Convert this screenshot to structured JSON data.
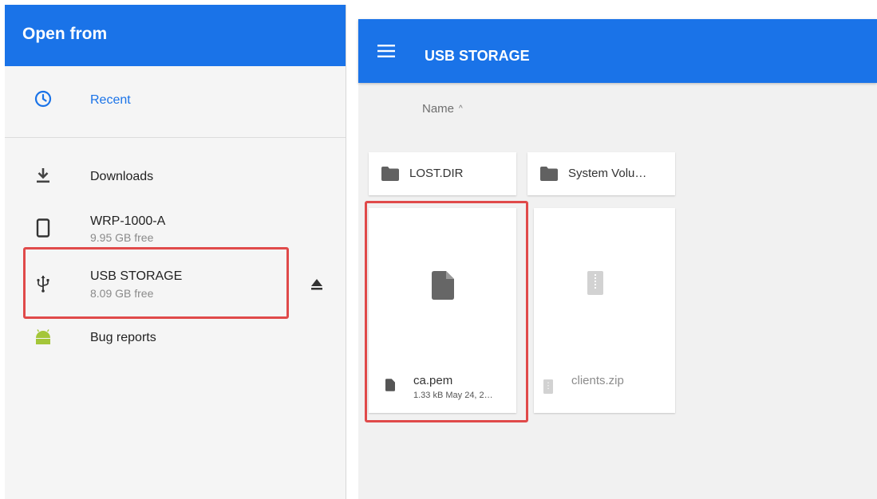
{
  "drawer": {
    "title": "Open from",
    "recent": "Recent",
    "items": [
      {
        "label": "Downloads",
        "sub": ""
      },
      {
        "label": "WRP-1000-A",
        "sub": "9.95 GB free"
      },
      {
        "label": "USB STORAGE",
        "sub": "8.09 GB free"
      },
      {
        "label": "Bug reports",
        "sub": ""
      }
    ]
  },
  "panel": {
    "title": "USB STORAGE",
    "sort": {
      "label": "Name",
      "arrow": "^"
    },
    "folders": [
      "LOST.DIR",
      "System Volu…"
    ],
    "files": [
      {
        "name": "ca.pem",
        "meta": "1.33 kB May 24, 2…"
      },
      {
        "name": "clients.zip",
        "meta": ""
      }
    ]
  },
  "colors": {
    "accent": "#1a73e8",
    "highlight": "#e04a4a",
    "android": "#a4c639"
  },
  "icons": [
    "clock-icon",
    "download-icon",
    "phone-icon",
    "usb-icon",
    "android-icon",
    "eject-icon",
    "menu-icon",
    "folder-icon",
    "file-icon",
    "zip-icon"
  ]
}
